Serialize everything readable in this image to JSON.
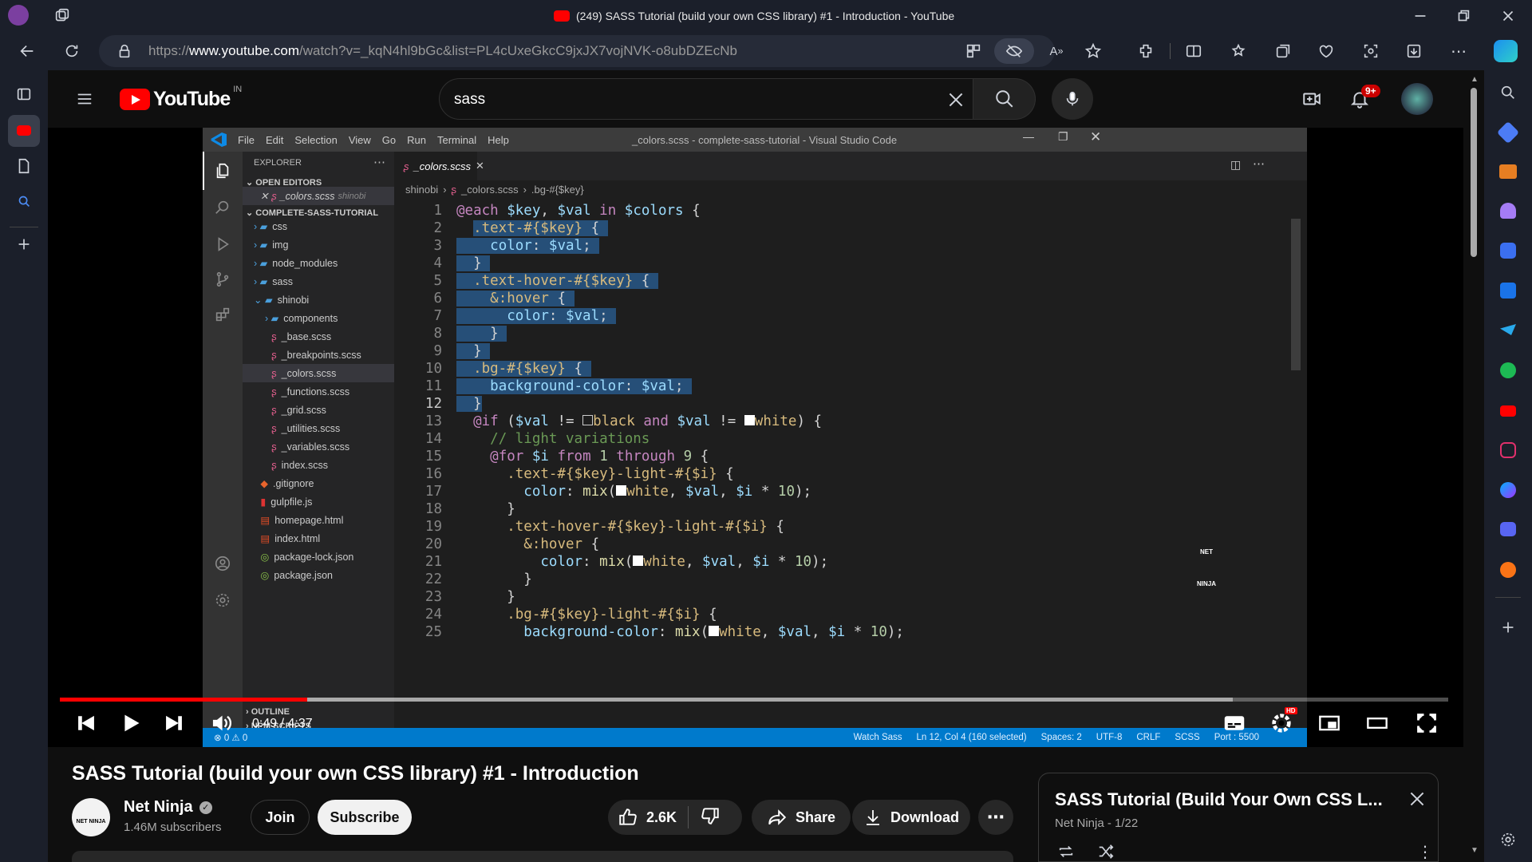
{
  "browser": {
    "tab_title": "(249) SASS Tutorial (build your own CSS library) #1 - Introduction - YouTube",
    "url_prefix": "https://",
    "url_domain": "www.youtube.com",
    "url_path": "/watch?v=_kqN4hl9bGc&list=PL4cUxeGkcC9jxJX7vojNVK-o8ubDZEcNb"
  },
  "youtube": {
    "logo_text": "YouTube",
    "region": "IN",
    "search_value": "sass",
    "notif_count": "9+"
  },
  "vscode": {
    "menu": [
      "File",
      "Edit",
      "Selection",
      "View",
      "Go",
      "Run",
      "Terminal",
      "Help"
    ],
    "window_title": "_colors.scss - complete-sass-tutorial - Visual Studio Code",
    "explorer_label": "EXPLORER",
    "open_editors_label": "OPEN EDITORS",
    "open_file": "_colors.scss",
    "open_file_folder": "shinobi",
    "project_label": "COMPLETE-SASS-TUTORIAL",
    "tree": [
      "css",
      "img",
      "node_modules",
      "sass",
      "shinobi",
      "components",
      "_base.scss",
      "_breakpoints.scss",
      "_colors.scss",
      "_functions.scss",
      "_grid.scss",
      "_utilities.scss",
      "_variables.scss",
      "index.scss",
      ".gitignore",
      "gulpfile.js",
      "homepage.html",
      "index.html",
      "package-lock.json",
      "package.json"
    ],
    "outline_label": "OUTLINE",
    "npm_label": "NPM SCRIPTS",
    "tab_label": "_colors.scss",
    "crumb_folder": "shinobi",
    "crumb_file": "_colors.scss",
    "crumb_symbol": ".bg-#{$key}",
    "line_numbers": [
      "1",
      "2",
      "3",
      "4",
      "5",
      "6",
      "7",
      "8",
      "9",
      "10",
      "11",
      "12",
      "13",
      "14",
      "15",
      "16",
      "17",
      "18",
      "19",
      "20",
      "21",
      "22",
      "23",
      "24",
      "25"
    ],
    "status_left": "⊗ 0 ⚠ 0",
    "status_items": [
      "Watch Sass",
      "Ln 12, Col 4 (160 selected)",
      "Spaces: 2",
      "UTF-8",
      "CRLF",
      "SCSS",
      "Port : 5500"
    ]
  },
  "player": {
    "time": "0:49 / 4:37",
    "progress_fraction": 0.178,
    "buffered_fraction": 0.845,
    "watermark": "NET NINJA"
  },
  "video_info": {
    "title": "SASS Tutorial (build your own CSS library) #1 - Introduction",
    "channel": "Net Ninja",
    "subscribers": "1.46M subscribers",
    "join_label": "Join",
    "subscribe_label": "Subscribe",
    "likes": "2.6K",
    "share_label": "Share",
    "download_label": "Download",
    "avatar_text": "NET NINJA"
  },
  "playlist": {
    "title": "SASS Tutorial (Build Your Own CSS L...",
    "subtitle": "Net Ninja - 1/22"
  }
}
